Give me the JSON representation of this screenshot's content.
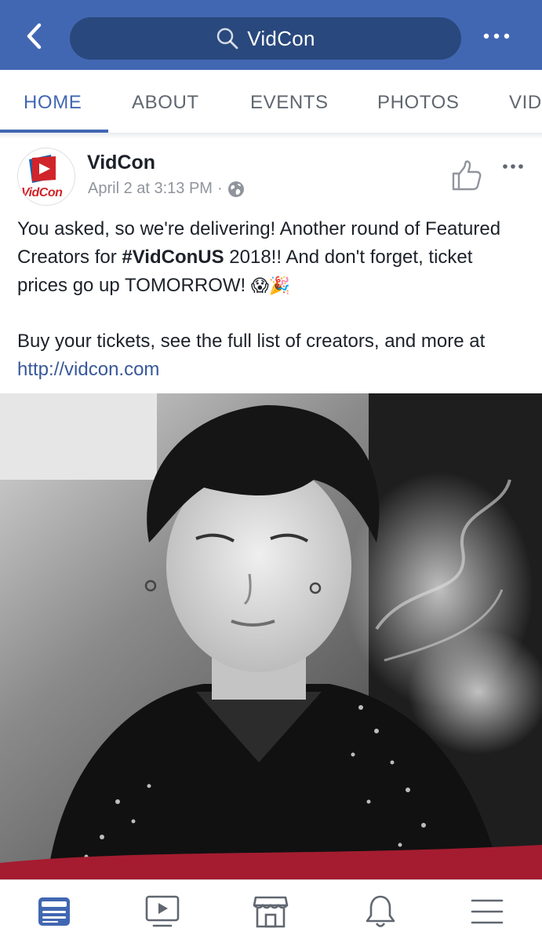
{
  "colors": {
    "brand_blue": "#4267b2",
    "search_bg": "#29487d",
    "link_blue": "#385898",
    "muted_gray": "#90949c",
    "vidcon_red": "#d0242a"
  },
  "header": {
    "back_icon": "chevron-left-icon",
    "search_icon": "search-icon",
    "search_value": "VidCon",
    "more_icon": "more-horizontal-icon"
  },
  "tabs": [
    {
      "label": "HOME",
      "active": true
    },
    {
      "label": "ABOUT",
      "active": false
    },
    {
      "label": "EVENTS",
      "active": false
    },
    {
      "label": "PHOTOS",
      "active": false
    },
    {
      "label": "VID",
      "active": false
    }
  ],
  "post": {
    "page_name": "VidCon",
    "avatar_logo_text": "VidCon",
    "timestamp": "April 2 at 3:13 PM",
    "separator": "·",
    "privacy_icon": "globe-icon",
    "like_icon": "thumbs-up-icon",
    "more_icon": "more-horizontal-icon",
    "text_line1_a": "You asked, so we're delivering! Another round of Featured Creators for ",
    "hashtag": "#VidConUS",
    "text_line1_b": " 2018!! And don't forget, ticket prices go up TOMORROW! ",
    "emojis": "😱🎉",
    "text_line2": "Buy your tickets, see the full list of creators, and more at ",
    "link": "http://vidcon.com"
  },
  "bottom_nav": [
    {
      "icon": "news-feed-icon",
      "active": true
    },
    {
      "icon": "video-icon",
      "active": false
    },
    {
      "icon": "marketplace-icon",
      "active": false
    },
    {
      "icon": "notifications-bell-icon",
      "active": false
    },
    {
      "icon": "menu-icon",
      "active": false
    }
  ]
}
